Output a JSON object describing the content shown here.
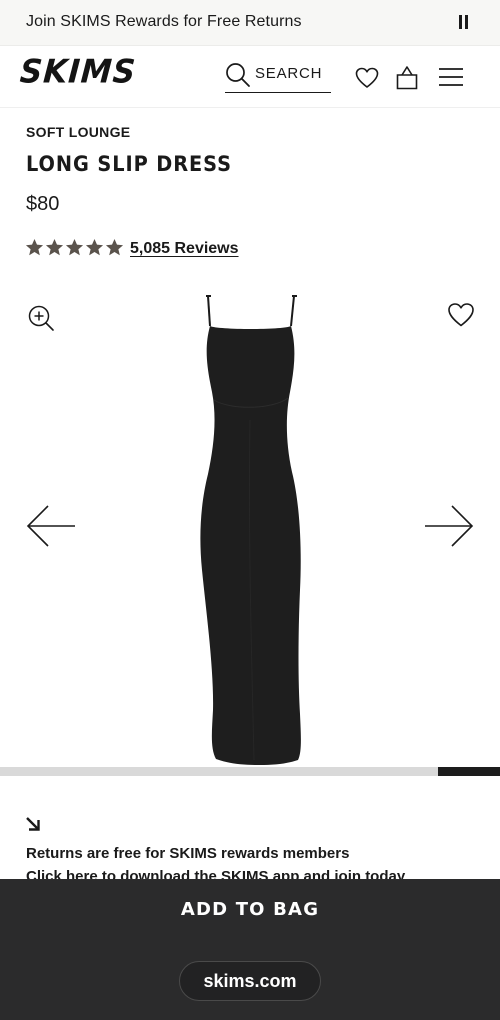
{
  "promo": {
    "text": "Join SKIMS Rewards for Free Returns",
    "pause_icon": "pause-icon"
  },
  "header": {
    "logo": "SKIMS",
    "search_label": "SEARCH",
    "icons": [
      "search-icon",
      "heart-icon",
      "bag-icon",
      "menu-icon"
    ]
  },
  "product": {
    "collection": "SOFT LOUNGE",
    "title": "LONG SLIP DRESS",
    "price": "$80",
    "rating": 5,
    "reviews": "5,085 Reviews",
    "dress_color": "#1e1e1e"
  },
  "gallery": {
    "icons": [
      "zoom-in-icon",
      "heart-icon",
      "arrow-left-icon",
      "arrow-right-icon"
    ],
    "progress_start": 0.875,
    "progress_end": 1.0
  },
  "returns": {
    "line1": "Returns are free for SKIMS rewards members",
    "line2": "Click here to download the SKIMS app and join today"
  },
  "bottom": {
    "cta": "ADD TO BAG",
    "url": "skims.com"
  },
  "colors": {
    "star": "#5a534c",
    "panel": "#2b2b2c",
    "text": "#1a1a1a"
  }
}
